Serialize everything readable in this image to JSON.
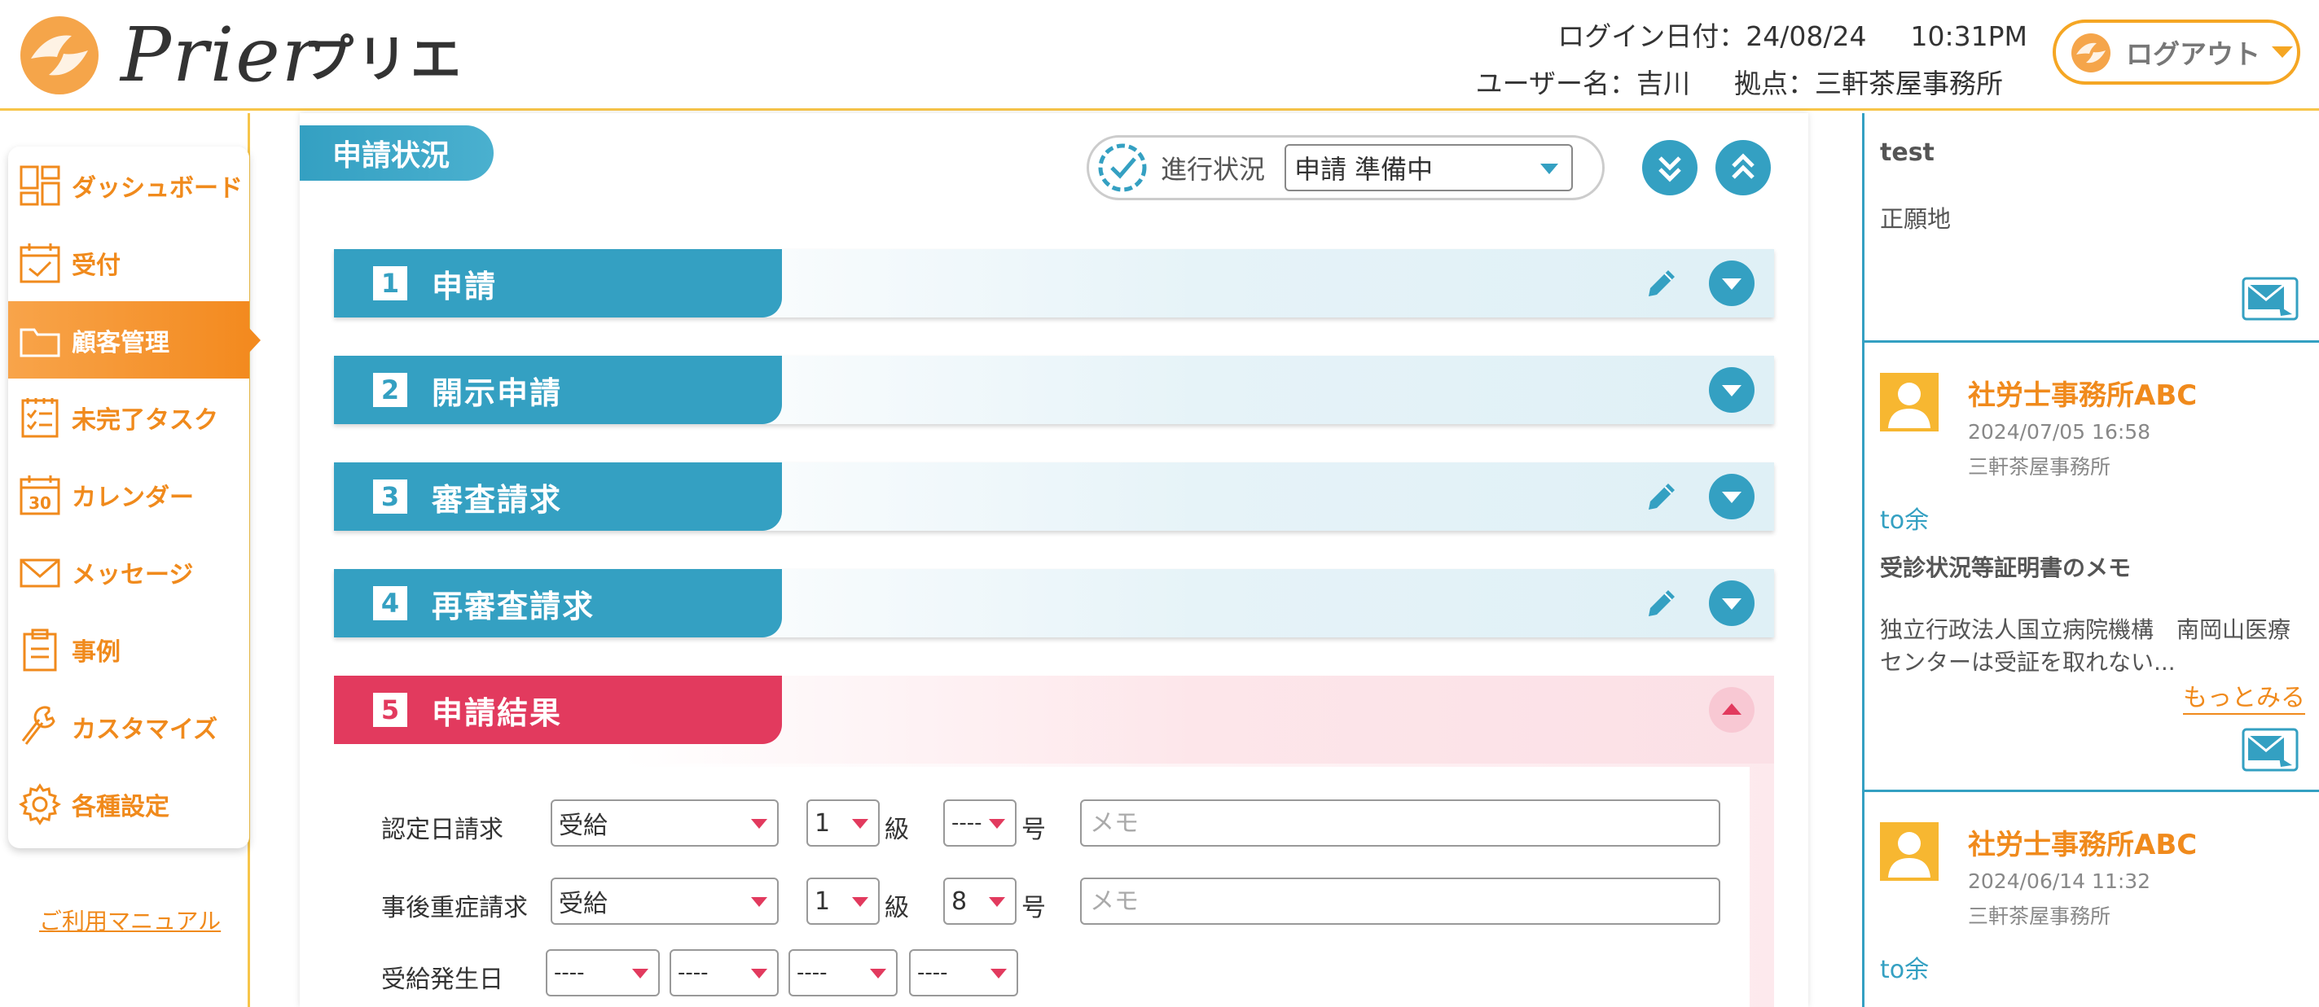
{
  "header": {
    "logo_text": "Prier",
    "brand_jp": "プリエ",
    "login_date_label": "ログイン日付：24/08/24",
    "login_time": "10:31PM",
    "user_label": "ユーザー名：吉川",
    "branch_label": "拠点：三軒茶屋事務所",
    "logout_label": "ログアウト"
  },
  "sidebar": {
    "items": [
      {
        "label": "ダッシュボード",
        "icon": "dashboard-icon"
      },
      {
        "label": "受付",
        "icon": "reception-icon"
      },
      {
        "label": "顧客管理",
        "icon": "folder-icon",
        "active": true
      },
      {
        "label": "未完了タスク",
        "icon": "task-list-icon"
      },
      {
        "label": "カレンダー",
        "icon": "calendar-icon"
      },
      {
        "label": "メッセージ",
        "icon": "mail-icon"
      },
      {
        "label": "事例",
        "icon": "clipboard-icon"
      },
      {
        "label": "カスタマイズ",
        "icon": "wrench-icon"
      },
      {
        "label": "各種設定",
        "icon": "gear-icon"
      }
    ],
    "manual_link": "ご利用マニュアル"
  },
  "main": {
    "status_tab": "申請状況",
    "progress_label": "進行状況",
    "progress_value": "申請 準備中",
    "sections": [
      {
        "num": "1",
        "title": "申請",
        "editable": true,
        "state": "collapsed"
      },
      {
        "num": "2",
        "title": "開示申請",
        "editable": false,
        "state": "collapsed"
      },
      {
        "num": "3",
        "title": "審査請求",
        "editable": true,
        "state": "collapsed"
      },
      {
        "num": "4",
        "title": "再審査請求",
        "editable": true,
        "state": "collapsed"
      },
      {
        "num": "5",
        "title": "申請結果",
        "editable": false,
        "state": "expanded"
      }
    ],
    "result": {
      "rows": [
        {
          "label": "認定日請求",
          "status": "受給",
          "grade": "1",
          "grade_unit": "級",
          "number": "----",
          "number_unit": "号",
          "memo_placeholder": "メモ"
        },
        {
          "label": "事後重症請求",
          "status": "受給",
          "grade": "1",
          "grade_unit": "級",
          "number": "8",
          "number_unit": "号",
          "memo_placeholder": "メモ"
        }
      ],
      "occurrence_label": "受給発生日",
      "occurrence_selects": [
        "----",
        "----",
        "----",
        "----"
      ]
    }
  },
  "messages": {
    "top_partial": {
      "subject": "test",
      "body": "正願地"
    },
    "items": [
      {
        "org": "社労士事務所ABC",
        "datetime": "2024/07/05 16:58",
        "branch": "三軒茶屋事務所",
        "to": "to余",
        "subject": "受診状況等証明書のメモ",
        "body_line1": "独立行政法人国立病院機構　南岡山医療",
        "body_line2": "センターは受証を取れない...",
        "more": "もっとみる"
      },
      {
        "org": "社労士事務所ABC",
        "datetime": "2024/06/14 11:32",
        "branch": "三軒茶屋事務所",
        "to": "to余"
      }
    ]
  },
  "colors": {
    "orange": "#f08a1c",
    "teal": "#34a0c2",
    "red": "#e23a5e",
    "yellow": "#f7c54a"
  }
}
